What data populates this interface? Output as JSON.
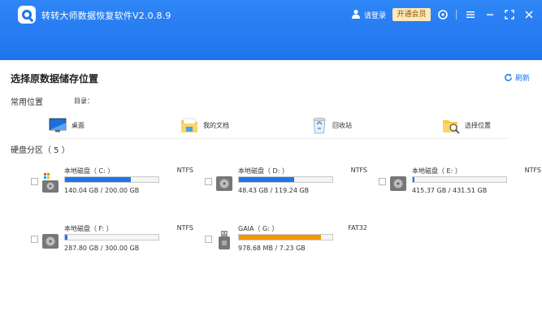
{
  "app": {
    "title": "转转大师数据恢复软件V2.0.8.9"
  },
  "header": {
    "login_label": "请登录",
    "vip_label": "开通会员",
    "icons": [
      "user-icon",
      "support-icon",
      "menu-icon",
      "minimize-icon",
      "maximize-icon",
      "close-icon"
    ]
  },
  "main": {
    "section_title": "选择原数据储存位置",
    "refresh_label": "刷新",
    "common_label": "常用位置",
    "dir_label": "目录：",
    "locations": [
      {
        "label": "桌面",
        "icon": "desktop-icon"
      },
      {
        "label": "我的文档",
        "icon": "documents-folder-icon"
      },
      {
        "label": "回收站",
        "icon": "recycle-bin-icon"
      },
      {
        "label": "选择位置",
        "icon": "browse-folder-icon"
      }
    ],
    "disks_label": "硬盘分区（ 5 ）",
    "disks": [
      {
        "name": "本地磁盘（ C: ）",
        "fs": "NTFS",
        "size": "140.04 GB / 200.00 GB",
        "used_fraction": 0.7,
        "system": true
      },
      {
        "name": "本地磁盘（ D: ）",
        "fs": "NTFS",
        "size": "48.43 GB / 119.24 GB",
        "used_fraction": 0.59
      },
      {
        "name": "本地磁盘（ E: ）",
        "fs": "NTFS",
        "size": "415.37 GB / 431.51 GB",
        "used_fraction": 0.02
      },
      {
        "name": "本地磁盘（ F: ）",
        "fs": "NTFS",
        "size": "287.80 GB / 300.00 GB",
        "used_fraction": 0.03
      },
      {
        "name": "GAIA（ G: ）",
        "fs": "FAT32",
        "size": "978.68 MB / 7.23 GB",
        "used_fraction": 0.88,
        "usb": true
      }
    ]
  },
  "colors": {
    "accent": "#1f74ec",
    "usb_bar": "#f39800",
    "vip_bg": "#ffe9b8"
  }
}
